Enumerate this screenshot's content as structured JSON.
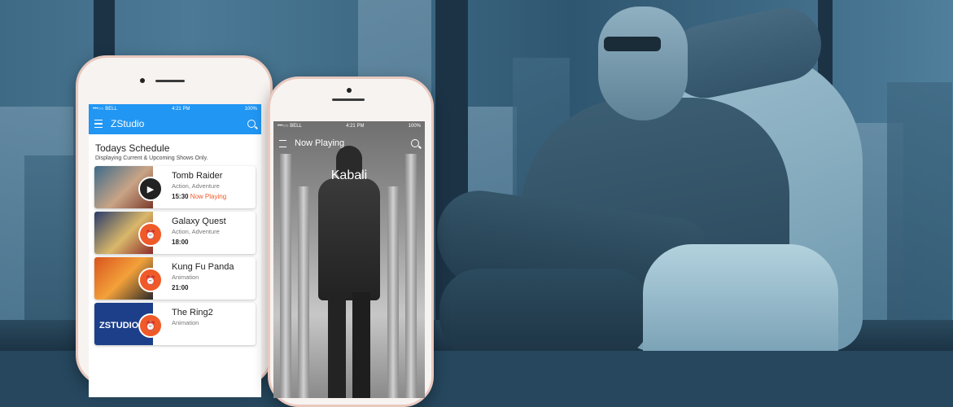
{
  "phone1": {
    "status": {
      "carrier": "•••○○ BELL",
      "time": "4:21 PM",
      "battery": "100%"
    },
    "app_title": "ZStudio",
    "schedule_title": "Todays Schedule",
    "schedule_subtitle": "Displaying Current & Upcoming Shows Only.",
    "shows": [
      {
        "name": "Tomb Raider",
        "genre": "Action, Adventure",
        "time": "15:30",
        "status": "Now Playing",
        "icon": "play-icon"
      },
      {
        "name": "Galaxy Quest",
        "genre": "Action, Adventure",
        "time": "18:00",
        "status": "",
        "icon": "alarm-icon"
      },
      {
        "name": "Kung Fu Panda",
        "genre": "Animation",
        "time": "21:00",
        "status": "",
        "icon": "alarm-icon"
      },
      {
        "name": "The Ring2",
        "genre": "Animation",
        "time": "",
        "status": "",
        "icon": "alarm-icon"
      }
    ],
    "thumb_label": "ZSTUDIO",
    "colors": {
      "appbar": "#2196f3",
      "accent": "#f05a28"
    }
  },
  "phone2": {
    "status": {
      "carrier": "•••○○ BELL",
      "time": "4:21 PM",
      "battery": "100%"
    },
    "app_title": "Now Playing",
    "movie_title": "Kabali"
  }
}
